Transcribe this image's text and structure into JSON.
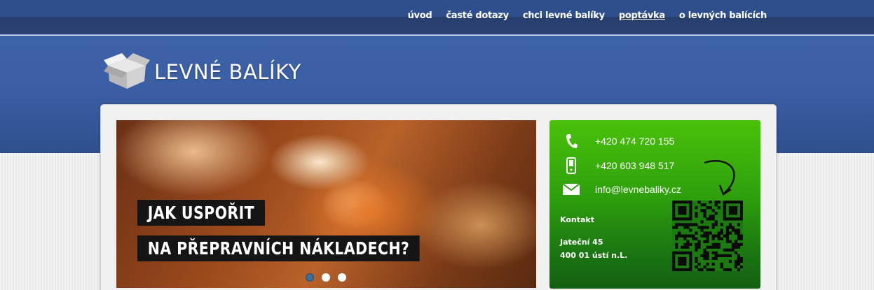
{
  "nav": {
    "items": [
      "úvod",
      "časté dotazy",
      "chci levné balíky",
      "poptávka",
      "o levných balících"
    ],
    "active_index": 3
  },
  "logo": {
    "text": "LEVNÉ BALÍKY",
    "icon": "box-icon"
  },
  "slider": {
    "caption_line1": "JAK USPOŘIT",
    "caption_line2": "NA PŘEPRAVNÍCH NÁKLADECH?",
    "slide_count": 3,
    "active_slide": 0
  },
  "contact": {
    "phone": "+420 474 720 155",
    "mobile": "+420 603 948 517",
    "email": "info@levnebaliky.cz",
    "section_label": "Kontakt",
    "address_line1": "Jateční 45",
    "address_line2": "400 01 ústí n.L.",
    "icons": [
      "phone-icon",
      "mobile-icon",
      "envelope-icon",
      "curved-arrow-icon",
      "qr-code"
    ]
  },
  "colors": {
    "nav_bg": "#2f4f8c",
    "header_bg": "#3b5fa4",
    "contact_green": "#3fb20c",
    "caption_bg": "#151515"
  }
}
